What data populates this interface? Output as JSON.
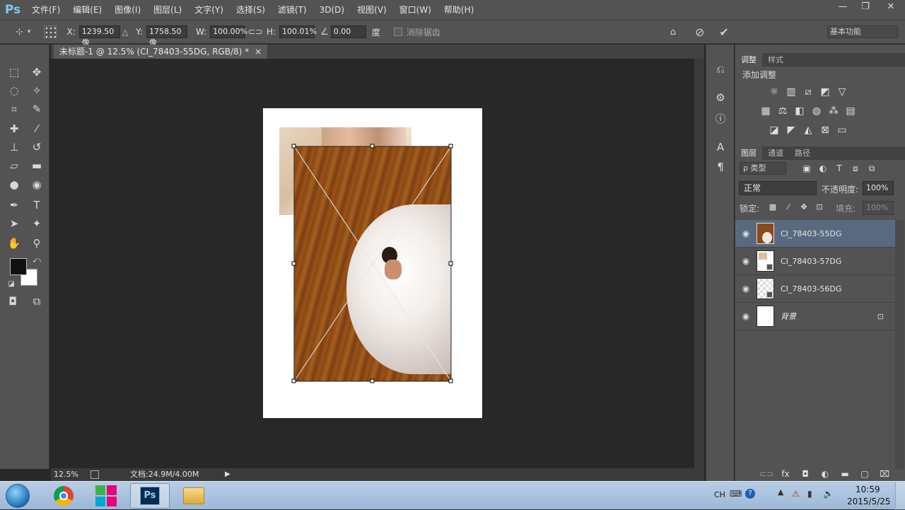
{
  "app": {
    "logo": "Ps",
    "menu": [
      "文件(F)",
      "编辑(E)",
      "图像(I)",
      "图层(L)",
      "文字(Y)",
      "选择(S)",
      "滤镜(T)",
      "3D(D)",
      "视图(V)",
      "窗口(W)",
      "帮助(H)"
    ],
    "window_controls": {
      "minimize": "—",
      "restore": "❐",
      "close": "✕"
    }
  },
  "options": {
    "x_label": "X:",
    "x_value": "1239.50 像",
    "y_label": "Y:",
    "y_value": "1758.50 像",
    "w_label": "W:",
    "w_value": "100.00%",
    "h_label": "H:",
    "h_value": "100.01%",
    "angle_value": "0.00",
    "angle_unit": "度",
    "antialias_label": "消除锯齿",
    "workspace": "基本功能"
  },
  "document": {
    "tab_title": "未标题-1 @ 12.5% (CI_78403-55DG, RGB/8) *",
    "tab_close": "×",
    "zoom": "12.5%",
    "doc_size": "文档:24.9M/4.00M"
  },
  "adjustments": {
    "tabs": [
      "调整",
      "样式"
    ],
    "header": "添加调整"
  },
  "layers_panel": {
    "tabs": [
      "图层",
      "通道",
      "路径"
    ],
    "filter_label": "ρ 类型",
    "blend_mode": "正常",
    "opacity_label": "不透明度:",
    "opacity_value": "100%",
    "lock_label": "锁定:",
    "fill_label": "填充:",
    "fill_value": "100%",
    "layers": [
      {
        "name": "CI_78403-55DG",
        "selected": true
      },
      {
        "name": "CI_78403-57DG",
        "selected": false
      },
      {
        "name": "CI_78403-56DG",
        "selected": false
      },
      {
        "name": "背景",
        "selected": false,
        "locked": true
      }
    ]
  },
  "taskbar": {
    "ime": "CH",
    "time": "10:59",
    "date": "2015/5/25"
  },
  "colors": {
    "ui_bg": "#535353",
    "canvas_bg": "#282828",
    "accent_blue": "#7fc6f3",
    "selected_layer": "#596a80"
  },
  "icons": [
    "move-icon",
    "marquee-icon",
    "lasso-icon",
    "magic-wand-icon",
    "crop-icon",
    "eyedropper-icon",
    "healing-icon",
    "brush-icon",
    "stamp-icon",
    "history-brush-icon",
    "eraser-icon",
    "gradient-icon",
    "blur-icon",
    "dodge-icon",
    "pen-icon",
    "type-icon",
    "path-select-icon",
    "shape-icon",
    "hand-icon",
    "zoom-icon"
  ]
}
